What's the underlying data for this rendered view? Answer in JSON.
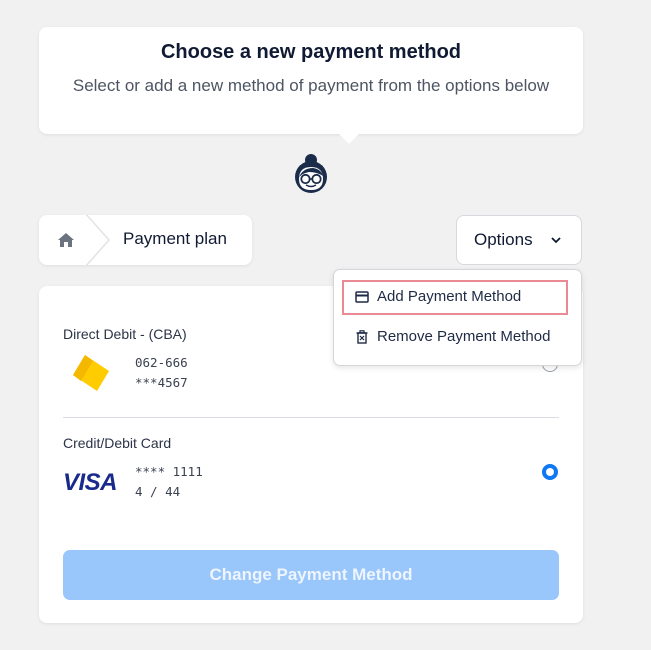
{
  "bubble": {
    "title": "Choose a new payment method",
    "subtitle": "Select or add a new method of payment from the options below"
  },
  "breadcrumb": {
    "home_icon": "home-icon",
    "label": "Payment plan"
  },
  "options": {
    "label": "Options",
    "menu": [
      {
        "label": "Add Payment Method",
        "icon": "card-icon",
        "highlighted": true
      },
      {
        "label": "Remove Payment Method",
        "icon": "trash-icon"
      }
    ]
  },
  "methods": [
    {
      "title": "Direct Debit - (CBA)",
      "line1": "062-666",
      "line2": "***4567",
      "selected": false
    },
    {
      "title": "Credit/Debit Card",
      "brand": "VISA",
      "line1": "**** 1111",
      "line2": "4 / 44",
      "selected": true
    }
  ],
  "change_button": "Change Payment Method",
  "colors": {
    "accent": "#1078f2",
    "button_disabled": "#99c6fb",
    "highlight_border": "#e98a94"
  }
}
